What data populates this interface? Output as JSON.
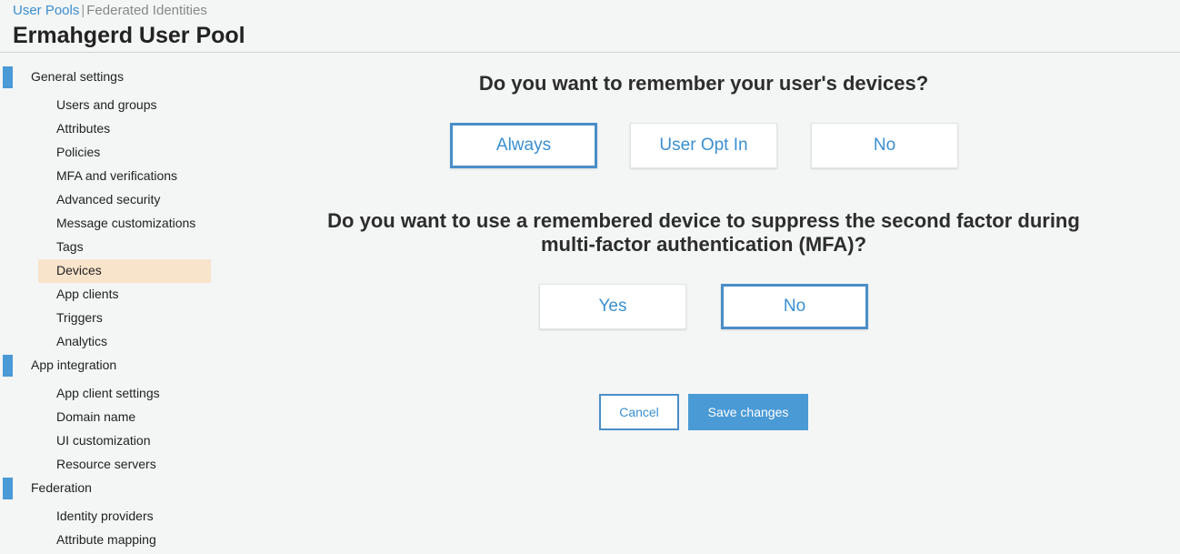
{
  "header": {
    "crumb_active": "User Pools",
    "crumb_separator": "|",
    "crumb_inactive": "Federated Identities",
    "title": "Ermahgerd User Pool"
  },
  "sidebar": {
    "general": {
      "label": "General settings",
      "items": [
        "Users and groups",
        "Attributes",
        "Policies",
        "MFA and verifications",
        "Advanced security",
        "Message customizations",
        "Tags",
        "Devices",
        "App clients",
        "Triggers",
        "Analytics"
      ]
    },
    "app_integration": {
      "label": "App integration",
      "items": [
        "App client settings",
        "Domain name",
        "UI customization",
        "Resource servers"
      ]
    },
    "federation": {
      "label": "Federation",
      "items": [
        "Identity providers",
        "Attribute mapping"
      ]
    },
    "active_item": "Devices"
  },
  "main": {
    "q1": {
      "text": "Do you want to remember your user's devices?",
      "options": [
        "Always",
        "User Opt In",
        "No"
      ],
      "selected": "Always"
    },
    "q2": {
      "line1": "Do you want to use a remembered device to suppress the second factor during",
      "line2": "multi-factor authentication (MFA)?",
      "options": [
        "Yes",
        "No"
      ],
      "selected": "No"
    },
    "cancel_label": "Cancel",
    "save_label": "Save changes"
  },
  "colors": {
    "accent": "#3b8fd0",
    "section_bar": "#4a9ad6",
    "active_item_bg": "#f8e4cb",
    "page_bg": "#f4f5f5"
  }
}
